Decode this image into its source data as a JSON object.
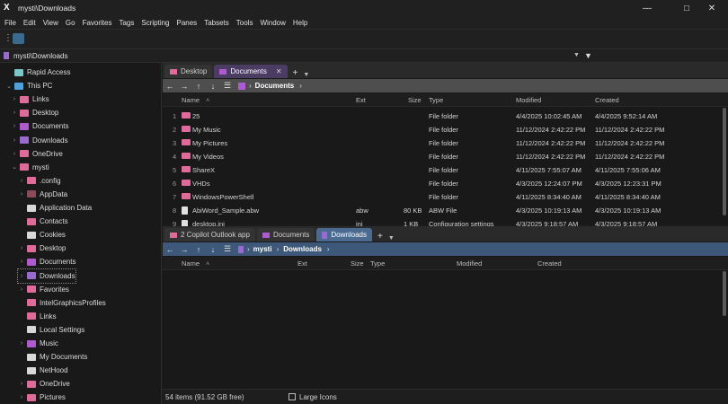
{
  "window": {
    "title": "mysti\\Downloads",
    "app_icon": "X"
  },
  "menu": [
    "File",
    "Edit",
    "View",
    "Go",
    "Favorites",
    "Tags",
    "Scripting",
    "Panes",
    "Tabsets",
    "Tools",
    "Window",
    "Help"
  ],
  "address": {
    "path": "mysti\\Downloads"
  },
  "sidebar": {
    "items": [
      {
        "label": "Rapid Access",
        "icon": "rapid-access-icon",
        "color": "#7ac7c7"
      },
      {
        "label": "This PC",
        "icon": "pc-icon",
        "color": "#4aa3e0"
      },
      {
        "label": "Links",
        "icon": "folder-icon",
        "color": "#e06a9a"
      },
      {
        "label": "Desktop",
        "icon": "folder-icon",
        "color": "#e06a9a"
      },
      {
        "label": "Documents",
        "icon": "folder-icon",
        "color": "#b05ad0"
      },
      {
        "label": "Downloads",
        "icon": "download-icon",
        "color": "#9a6ad0"
      },
      {
        "label": "OneDrive",
        "icon": "folder-icon",
        "color": "#e06a9a"
      },
      {
        "label": "mysti",
        "icon": "folder-icon",
        "color": "#e06a9a"
      },
      {
        "label": ".config",
        "icon": "folder-icon",
        "color": "#e06a9a"
      },
      {
        "label": "AppData",
        "icon": "folder-icon",
        "color": "#8a4a5a"
      },
      {
        "label": "Application Data",
        "icon": "folder-link-icon",
        "color": "#d8d8d8"
      },
      {
        "label": "Contacts",
        "icon": "folder-icon",
        "color": "#e06a9a"
      },
      {
        "label": "Cookies",
        "icon": "folder-link-icon",
        "color": "#d8d8d8"
      },
      {
        "label": "Desktop",
        "icon": "folder-icon",
        "color": "#e06a9a"
      },
      {
        "label": "Documents",
        "icon": "folder-icon",
        "color": "#b05ad0"
      },
      {
        "label": "Downloads",
        "icon": "download-icon",
        "color": "#9a6ad0"
      },
      {
        "label": "Favorites",
        "icon": "folder-icon",
        "color": "#e06a9a"
      },
      {
        "label": "IntelGraphicsProfiles",
        "icon": "folder-icon",
        "color": "#e06a9a"
      },
      {
        "label": "Links",
        "icon": "folder-icon",
        "color": "#e06a9a"
      },
      {
        "label": "Local Settings",
        "icon": "folder-link-icon",
        "color": "#d8d8d8"
      },
      {
        "label": "Music",
        "icon": "music-icon",
        "color": "#b05ad0"
      },
      {
        "label": "My Documents",
        "icon": "folder-link-icon",
        "color": "#d8d8d8"
      },
      {
        "label": "NetHood",
        "icon": "folder-link-icon",
        "color": "#d8d8d8"
      },
      {
        "label": "OneDrive",
        "icon": "folder-icon",
        "color": "#e06a9a"
      },
      {
        "label": "Pictures",
        "icon": "pictures-icon",
        "color": "#e06a9a"
      }
    ]
  },
  "upper_pane": {
    "tabs": [
      {
        "label": "Desktop"
      },
      {
        "label": "Documents"
      }
    ],
    "breadcrumb": "Documents",
    "columns": {
      "name": "Name",
      "ext": "Ext",
      "size": "Size",
      "type": "Type",
      "modified": "Modified",
      "created": "Created"
    },
    "rows": [
      {
        "num": "1",
        "name": "25",
        "ext": "",
        "size": "",
        "type": "File folder",
        "modified": "4/4/2025 10:02:45 AM",
        "created": "4/4/2025 9:52:14 AM"
      },
      {
        "num": "2",
        "name": "My Music",
        "ext": "",
        "size": "",
        "type": "File folder",
        "modified": "11/12/2024 2:42:22 PM",
        "created": "11/12/2024 2:42:22 PM"
      },
      {
        "num": "3",
        "name": "My Pictures",
        "ext": "",
        "size": "",
        "type": "File folder",
        "modified": "11/12/2024 2:42:22 PM",
        "created": "11/12/2024 2:42:22 PM"
      },
      {
        "num": "4",
        "name": "My Videos",
        "ext": "",
        "size": "",
        "type": "File folder",
        "modified": "11/12/2024 2:42:22 PM",
        "created": "11/12/2024 2:42:22 PM"
      },
      {
        "num": "5",
        "name": "ShareX",
        "ext": "",
        "size": "",
        "type": "File folder",
        "modified": "4/11/2025 7:55:07 AM",
        "created": "4/11/2025 7:55:06 AM"
      },
      {
        "num": "6",
        "name": "VHDs",
        "ext": "",
        "size": "",
        "type": "File folder",
        "modified": "4/3/2025 12:24:07 PM",
        "created": "4/3/2025 12:23:31 PM"
      },
      {
        "num": "7",
        "name": "WindowsPowerShell",
        "ext": "",
        "size": "",
        "type": "File folder",
        "modified": "4/11/2025 8:34:40 AM",
        "created": "4/11/2025 8:34:40 AM"
      },
      {
        "num": "8",
        "name": "AbiWord_Sample.abw",
        "ext": "abw",
        "size": "80 KB",
        "type": "ABW File",
        "modified": "4/3/2025 10:19:13 AM",
        "created": "4/3/2025 10:19:13 AM"
      },
      {
        "num": "9",
        "name": "desktop.ini",
        "ext": "ini",
        "size": "1 KB",
        "type": "Configuration settings",
        "modified": "4/3/2025 9:18:57 AM",
        "created": "4/3/2025 9:18:57 AM"
      }
    ]
  },
  "lower_pane": {
    "tabs": [
      {
        "label": "2 Copilot Outlook app"
      },
      {
        "label": "Documents"
      },
      {
        "label": "Downloads"
      }
    ],
    "breadcrumb": [
      "mysti",
      "Downloads"
    ],
    "columns": {
      "name": "Name",
      "ext": "Ext",
      "size": "Size",
      "type": "Type",
      "modified": "Modified",
      "created": "Created"
    }
  },
  "status": {
    "items": "54 items (91.52 GB free)",
    "view": "Large Icons"
  }
}
